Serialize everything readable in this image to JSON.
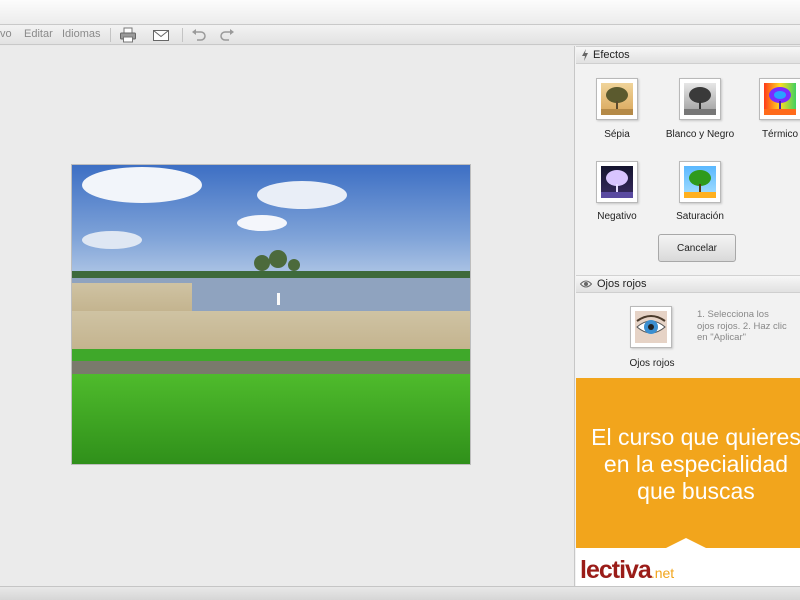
{
  "menu": {
    "archivo": "vo",
    "editar": "Editar",
    "idiomas": "Idiomas"
  },
  "toolbar": {
    "icons": [
      "printer-icon",
      "mail-icon",
      "undo-icon",
      "redo-icon"
    ]
  },
  "effects": {
    "title": "Efectos",
    "items": [
      {
        "label": "Sépia",
        "icon": "tree-sepia"
      },
      {
        "label": "Blanco y Negro",
        "icon": "tree-bw"
      },
      {
        "label": "Térmico",
        "icon": "tree-thermal"
      },
      {
        "label": "Negativo",
        "icon": "tree-negative"
      },
      {
        "label": "Saturación",
        "icon": "tree-saturation"
      }
    ],
    "cancel_label": "Cancelar"
  },
  "red_eye": {
    "title": "Ojos rojos",
    "label": "Ojos rojos",
    "instructions": "1. Selecciona los ojos rojos. 2. Haz clic en \"Aplicar\""
  },
  "ad": {
    "line1": "El curso que quieres",
    "line2": "en la especialidad",
    "line3": "que buscas",
    "logo": "lectiva",
    "logo_suffix": ".net"
  },
  "colors": {
    "ad_orange": "#f2a51c",
    "logo_red": "#9a1c18"
  }
}
